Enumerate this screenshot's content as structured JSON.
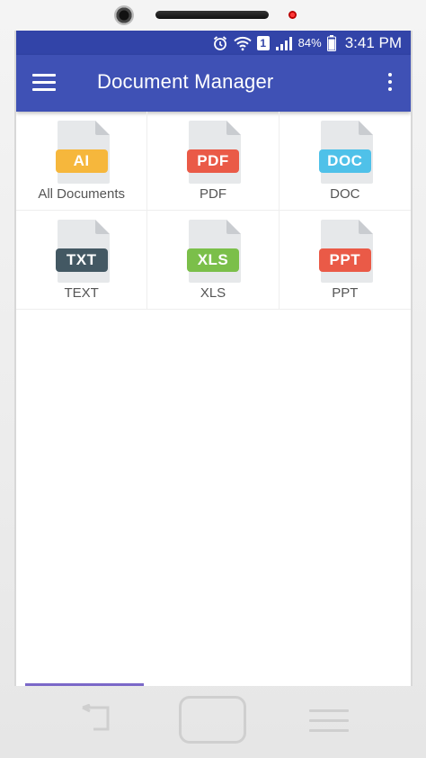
{
  "status_bar": {
    "battery": "84%",
    "time": "3:41 PM",
    "sim_slot": "1",
    "icons": [
      "alarm-icon",
      "wifi-icon",
      "signal-icon",
      "battery-icon"
    ]
  },
  "app_bar": {
    "title": "Document Manager",
    "menu_icon": "hamburger-menu-icon",
    "overflow_icon": "more-vert-icon",
    "color": "#3f51b5",
    "status_color": "#3244a8"
  },
  "categories": [
    {
      "badge": "AI",
      "label": "All Documents",
      "color": "#f6b73c"
    },
    {
      "badge": "PDF",
      "label": "PDF",
      "color": "#ea5a47"
    },
    {
      "badge": "DOC",
      "label": "DOC",
      "color": "#4fc1e9"
    },
    {
      "badge": "TXT",
      "label": "TEXT",
      "color": "#435863"
    },
    {
      "badge": "XLS",
      "label": "XLS",
      "color": "#7bbf4a"
    },
    {
      "badge": "PPT",
      "label": "PPT",
      "color": "#ea5a47"
    }
  ],
  "nav": {
    "back_icon": "back-arrow-icon",
    "home_icon": "home-button-icon",
    "menu_icon": "menu-lines-icon"
  }
}
